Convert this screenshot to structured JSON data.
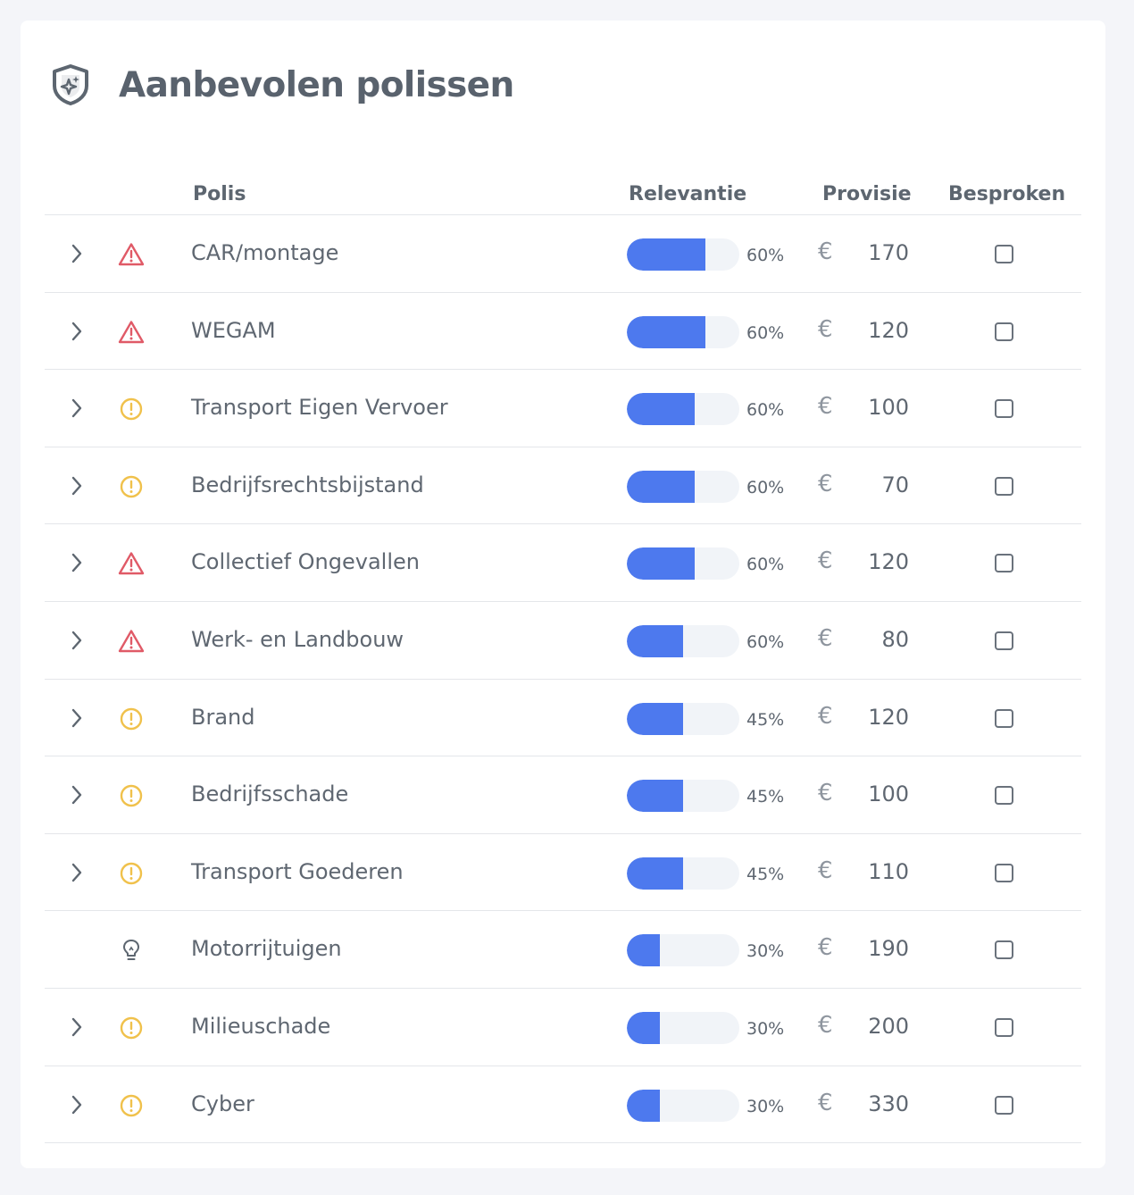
{
  "title": "Aanbevolen polissen",
  "columns": {
    "polis": "Polis",
    "relevantie": "Relevantie",
    "provisie": "Provisie",
    "besproken": "Besproken"
  },
  "currency_symbol": "€",
  "colors": {
    "accent": "#4d79ee",
    "warning_red": "#e05a67",
    "warning_yellow": "#f0c14b"
  },
  "rows": [
    {
      "name": "CAR/montage",
      "status_icon": "alert-triangle-icon",
      "expandable": true,
      "relevance": 0.7,
      "relevance_label": "60%",
      "commission": "170",
      "discussed": false
    },
    {
      "name": "WEGAM",
      "status_icon": "alert-triangle-icon",
      "expandable": true,
      "relevance": 0.7,
      "relevance_label": "60%",
      "commission": "120",
      "discussed": false
    },
    {
      "name": "Transport Eigen Vervoer",
      "status_icon": "alert-circle-icon",
      "expandable": true,
      "relevance": 0.6,
      "relevance_label": "60%",
      "commission": "100",
      "discussed": false
    },
    {
      "name": "Bedrijfsrechtsbijstand",
      "status_icon": "alert-circle-icon",
      "expandable": true,
      "relevance": 0.6,
      "relevance_label": "60%",
      "commission": "70",
      "discussed": false
    },
    {
      "name": "Collectief Ongevallen",
      "status_icon": "alert-triangle-icon",
      "expandable": true,
      "relevance": 0.6,
      "relevance_label": "60%",
      "commission": "120",
      "discussed": false
    },
    {
      "name": "Werk- en Landbouw",
      "status_icon": "alert-triangle-icon",
      "expandable": true,
      "relevance": 0.5,
      "relevance_label": "60%",
      "commission": "80",
      "discussed": false
    },
    {
      "name": "Brand",
      "status_icon": "alert-circle-icon",
      "expandable": true,
      "relevance": 0.5,
      "relevance_label": "45%",
      "commission": "120",
      "discussed": false
    },
    {
      "name": "Bedrijfsschade",
      "status_icon": "alert-circle-icon",
      "expandable": true,
      "relevance": 0.5,
      "relevance_label": "45%",
      "commission": "100",
      "discussed": false
    },
    {
      "name": "Transport Goederen",
      "status_icon": "alert-circle-icon",
      "expandable": true,
      "relevance": 0.5,
      "relevance_label": "45%",
      "commission": "110",
      "discussed": false
    },
    {
      "name": "Motorrijtuigen",
      "status_icon": "lightbulb-icon",
      "expandable": false,
      "relevance": 0.29,
      "relevance_label": "30%",
      "commission": "190",
      "discussed": false
    },
    {
      "name": "Milieuschade",
      "status_icon": "alert-circle-icon",
      "expandable": true,
      "relevance": 0.29,
      "relevance_label": "30%",
      "commission": "200",
      "discussed": false
    },
    {
      "name": "Cyber",
      "status_icon": "alert-circle-icon",
      "expandable": true,
      "relevance": 0.29,
      "relevance_label": "30%",
      "commission": "330",
      "discussed": false
    }
  ]
}
